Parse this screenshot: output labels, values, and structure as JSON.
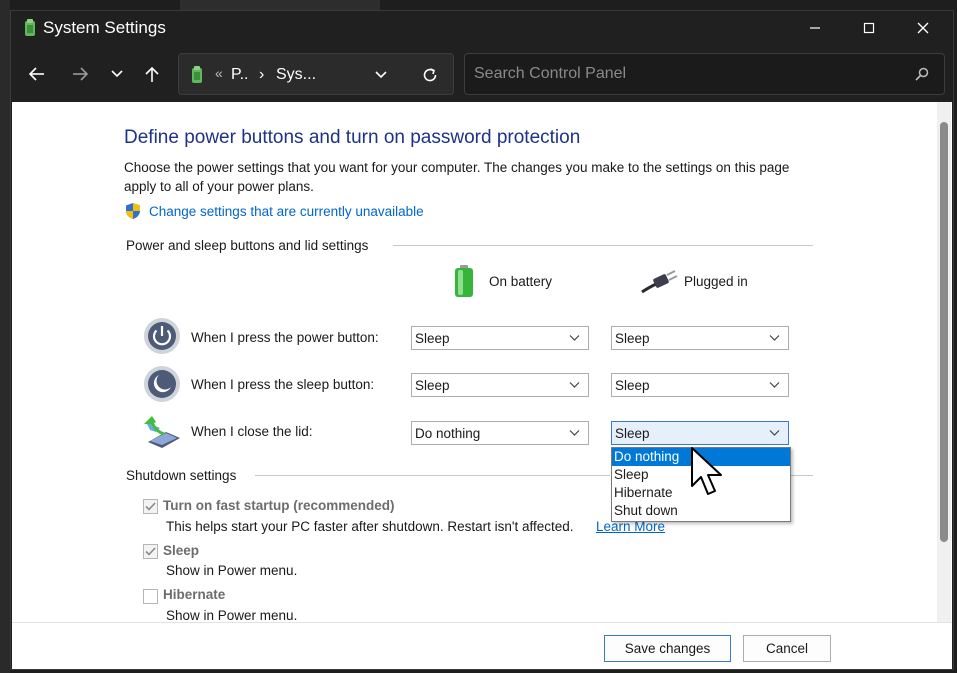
{
  "window": {
    "title": "System Settings",
    "minimize_icon": "minimize-icon",
    "maximize_icon": "maximize-icon",
    "close_icon": "close-icon"
  },
  "toolbar": {
    "back_icon": "back-arrow-icon",
    "forward_icon": "forward-arrow-icon",
    "recent_icon": "chevron-down-icon",
    "up_icon": "up-arrow-icon",
    "address": {
      "overflow": "«",
      "crumb_1": "P..",
      "separator": "›",
      "crumb_2": "Sys..."
    },
    "refresh_icon": "refresh-icon",
    "search_placeholder": "Search Control Panel"
  },
  "page": {
    "title": "Define power buttons and turn on password protection",
    "description": "Choose the power settings that you want for your computer. The changes you make to the settings on this page apply to all of your power plans.",
    "change_link": "Change settings that are currently unavailable"
  },
  "buttons_section": {
    "heading": "Power and sleep buttons and lid settings",
    "col_battery": "On battery",
    "col_plugged": "Plugged in",
    "rows": [
      {
        "label": "When I press the power button:",
        "battery": "Sleep",
        "plugged": "Sleep"
      },
      {
        "label": "When I press the sleep button:",
        "battery": "Sleep",
        "plugged": "Sleep"
      },
      {
        "label": "When I close the lid:",
        "battery": "Do nothing",
        "plugged": "Sleep"
      }
    ]
  },
  "dropdown": {
    "options": [
      "Do nothing",
      "Sleep",
      "Hibernate",
      "Shut down"
    ],
    "highlighted": "Do nothing"
  },
  "shutdown_section": {
    "heading": "Shutdown settings",
    "items": [
      {
        "label": "Turn on fast startup (recommended)",
        "desc": "This helps start your PC faster after shutdown. Restart isn't affected.",
        "link": "Learn More",
        "checked": true
      },
      {
        "label": "Sleep",
        "desc": "Show in Power menu.",
        "checked": true
      },
      {
        "label": "Hibernate",
        "desc": "Show in Power menu.",
        "checked": false
      }
    ]
  },
  "footer": {
    "save": "Save changes",
    "cancel": "Cancel"
  },
  "colors": {
    "accent": "#0078d7",
    "title_blue": "#1e3287",
    "link": "#0066cc"
  }
}
